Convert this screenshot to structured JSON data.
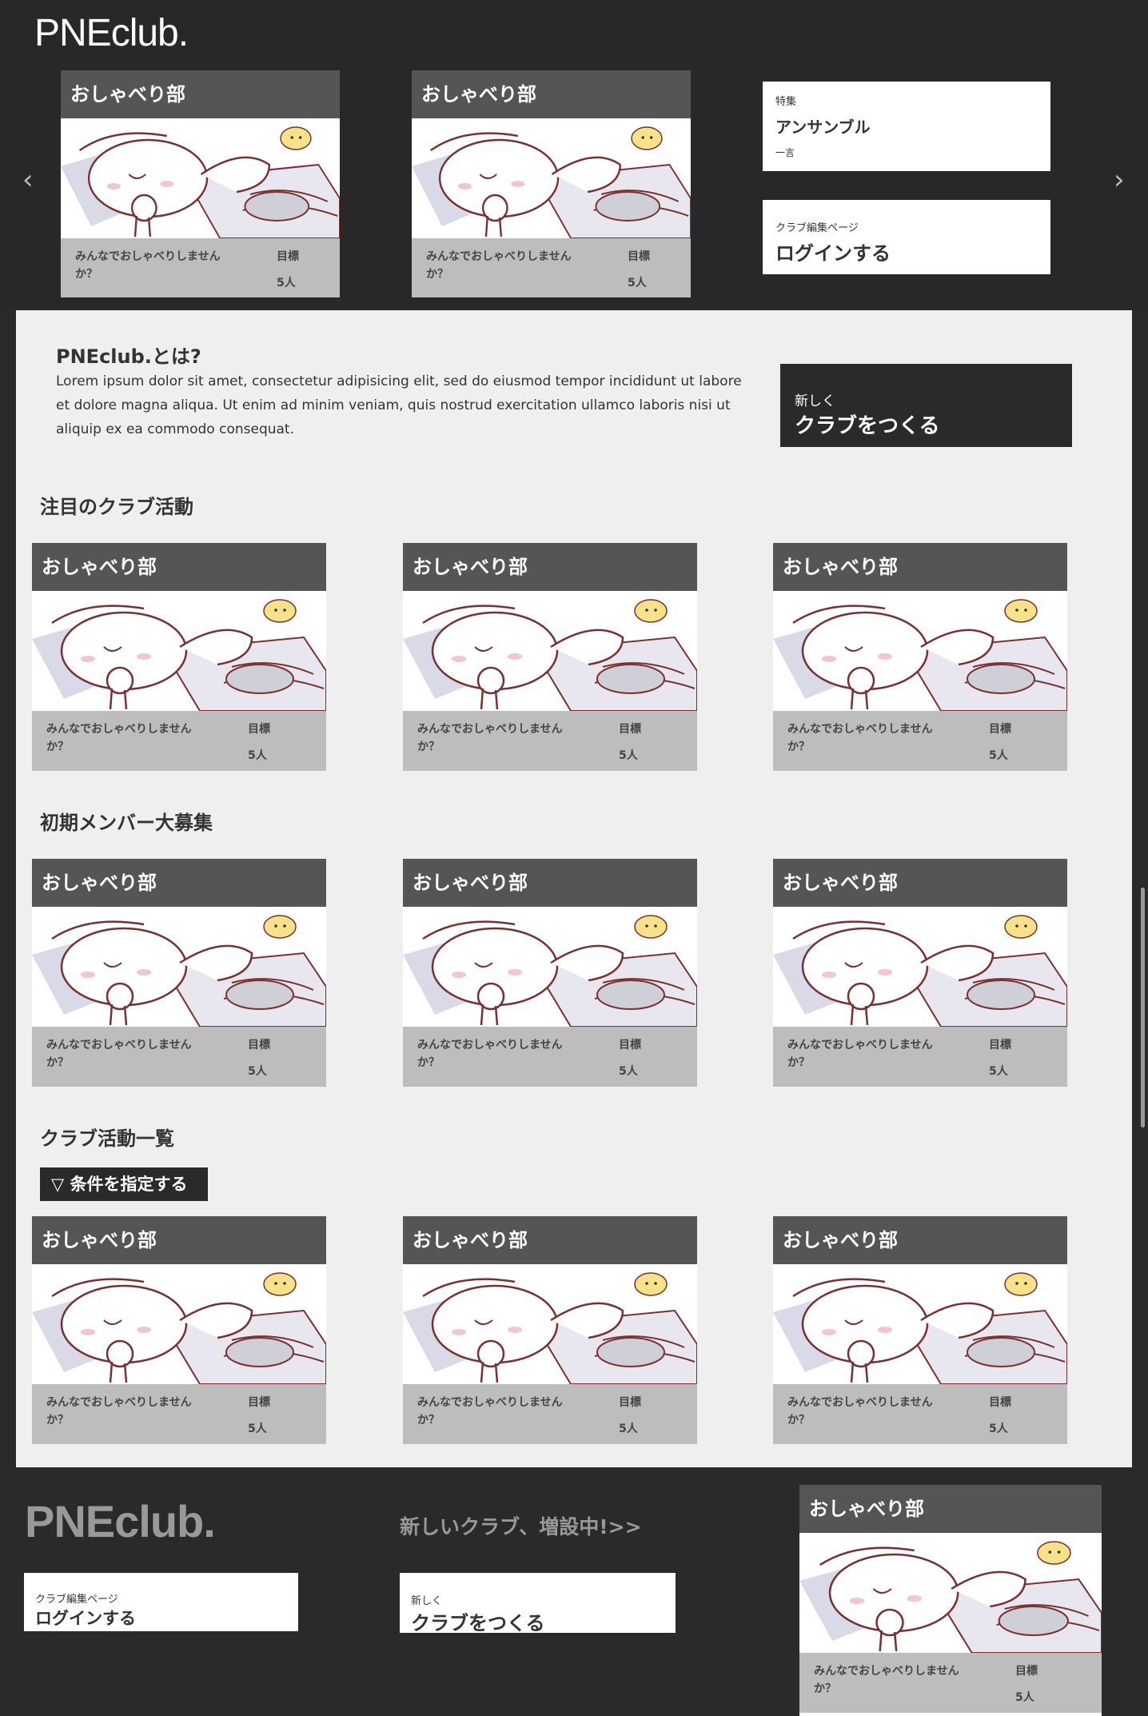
{
  "header": {
    "brand": "PNEclub.",
    "prev_arrow": "‹",
    "next_arrow": "›"
  },
  "club_card": {
    "title": "おしゃべり部",
    "description": "みんなでおしゃべりしませんか？",
    "goal_label": "目標",
    "goal_value": "5人"
  },
  "feature": {
    "label": "特集",
    "title": "アンサンブル",
    "note": "一言"
  },
  "login_box": {
    "label": "クラブ編集ページ",
    "action": "ログインする"
  },
  "about": {
    "title": "PNEclub.とは?",
    "text": "Lorem ipsum dolor sit amet, consectetur adipisicing elit, sed do eiusmod tempor incididunt ut labore et dolore magna aliqua. Ut enim ad minim veniam, quis nostrud exercitation ullamco laboris nisi ut aliquip ex ea commodo consequat."
  },
  "create_box": {
    "label": "新しく",
    "action": "クラブをつくる"
  },
  "sections": {
    "featured": "注目のクラブ活動",
    "recruiting": "初期メンバー大募集",
    "all": "クラブ活動一覧"
  },
  "filter": {
    "label": "▽ 条件を指定する"
  },
  "footer": {
    "brand": "PNEclub.",
    "new_clubs": "新しいクラブ、増設中!>>",
    "login_label": "クラブ編集ページ",
    "login_action": "ログインする",
    "create_label": "新しく",
    "create_action": "クラブをつくる"
  },
  "colors": {
    "dark": "#282828",
    "card_header": "#555555",
    "card_footer": "#bdbdbd",
    "content_bg": "#efefef"
  }
}
